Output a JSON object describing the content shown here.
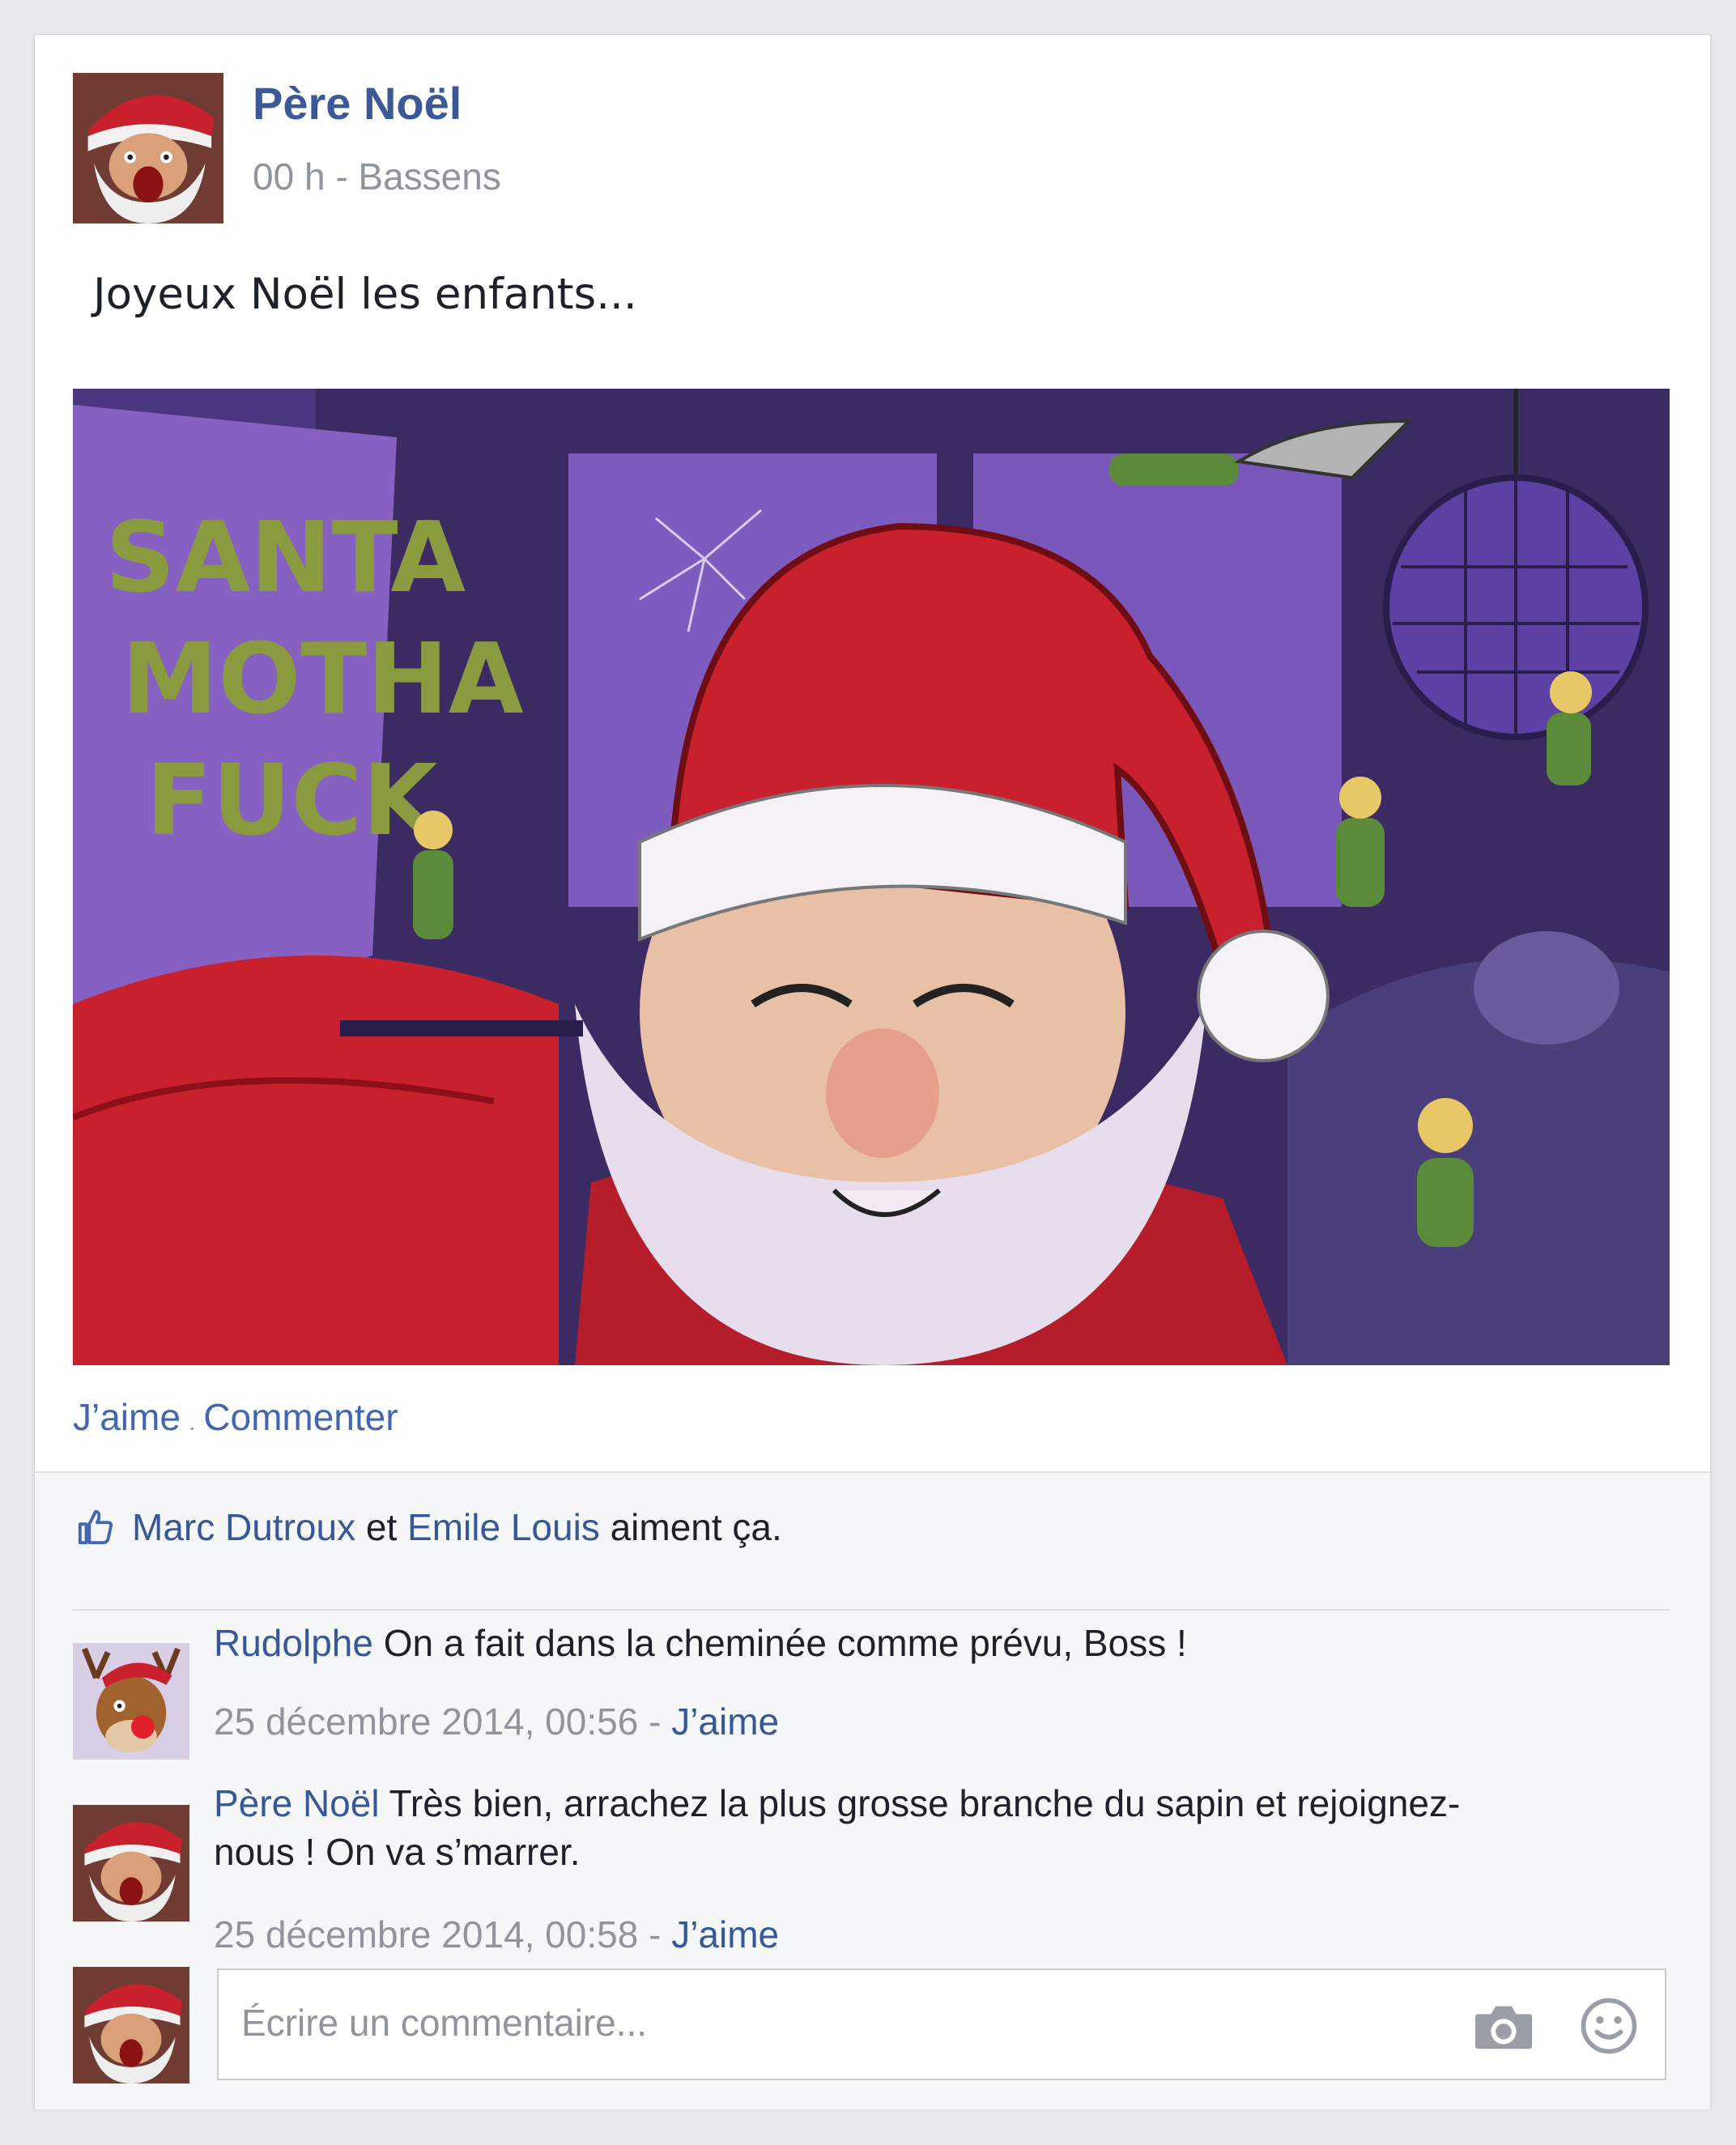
{
  "post": {
    "author": "Père Noël",
    "time": "00 h",
    "separator": "-",
    "location": "Bassens",
    "text": "Joyeux Noël les enfants...",
    "graffiti": [
      "SANTA",
      "MOTHA",
      "FUCK"
    ],
    "actions": {
      "like": "J’aime",
      "dot": ".",
      "comment": "Commenter"
    }
  },
  "likes": {
    "name1": "Marc Dutroux",
    "connector": "et",
    "name2": "Emile Louis",
    "suffix": "aiment ça."
  },
  "comments": [
    {
      "author": "Rudolphe",
      "text": "On a fait dans la cheminée comme prévu, Boss !",
      "date": "25 décembre 2014, 00:56",
      "separator": "-",
      "like": "J’aime"
    },
    {
      "author": "Père Noël",
      "text_line1": "Très bien, arrachez la plus grosse branche du sapin et rejoignez-",
      "text_line2": "nous ! On va s’marrer.",
      "date": "25 décembre 2014, 00:58",
      "separator": "-",
      "like": "J’aime"
    }
  ],
  "composer": {
    "placeholder": "Écrire un commentaire..."
  },
  "colors": {
    "link": "#365899",
    "author": "#3b5998",
    "muted": "#90949c",
    "purple_bg": "#5b3b8e",
    "santa_red": "#c8202c"
  }
}
